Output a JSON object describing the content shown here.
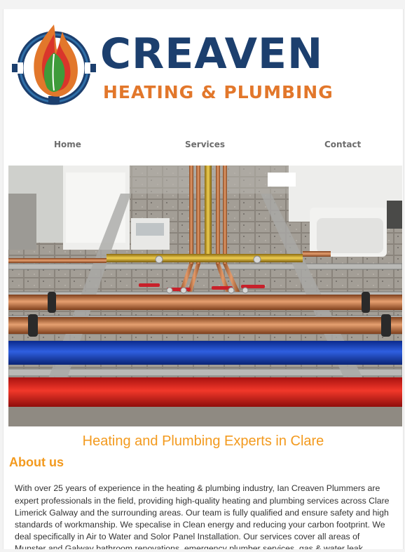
{
  "brand": {
    "name": "CREAVEN",
    "subtitle": "HEATING & PLUMBING",
    "colors": {
      "navy": "#1c3f6e",
      "orange": "#e2772b",
      "flame_red": "#d9352b",
      "leaf_green": "#3e9b3a"
    }
  },
  "nav": {
    "home": "Home",
    "services": "Services",
    "contact": "Contact"
  },
  "hero": {
    "icon": "plumbing-photo"
  },
  "main": {
    "tagline": "Heating and Plumbing Experts in Clare",
    "about_title": "About us",
    "about_text": "With over 25 years of experience in the heating & plumbing industry, Ian Creaven Plummers are expert professionals in the field, providing high-quality heating and plumbing services across Clare Limerick Galway and the surrounding areas. Our team is fully qualified and ensure safety and high standards of workmanship. We specalise in Clean energy and reducing your carbon footprint. We deal specifically in Air to Water and Solor Panel Installation. Our services cover all areas of Munster and Galway bathroom renovations, emergency plumber services, gas & water leak detection services, underfloor heating"
  },
  "accent_color": "#f39a1e"
}
